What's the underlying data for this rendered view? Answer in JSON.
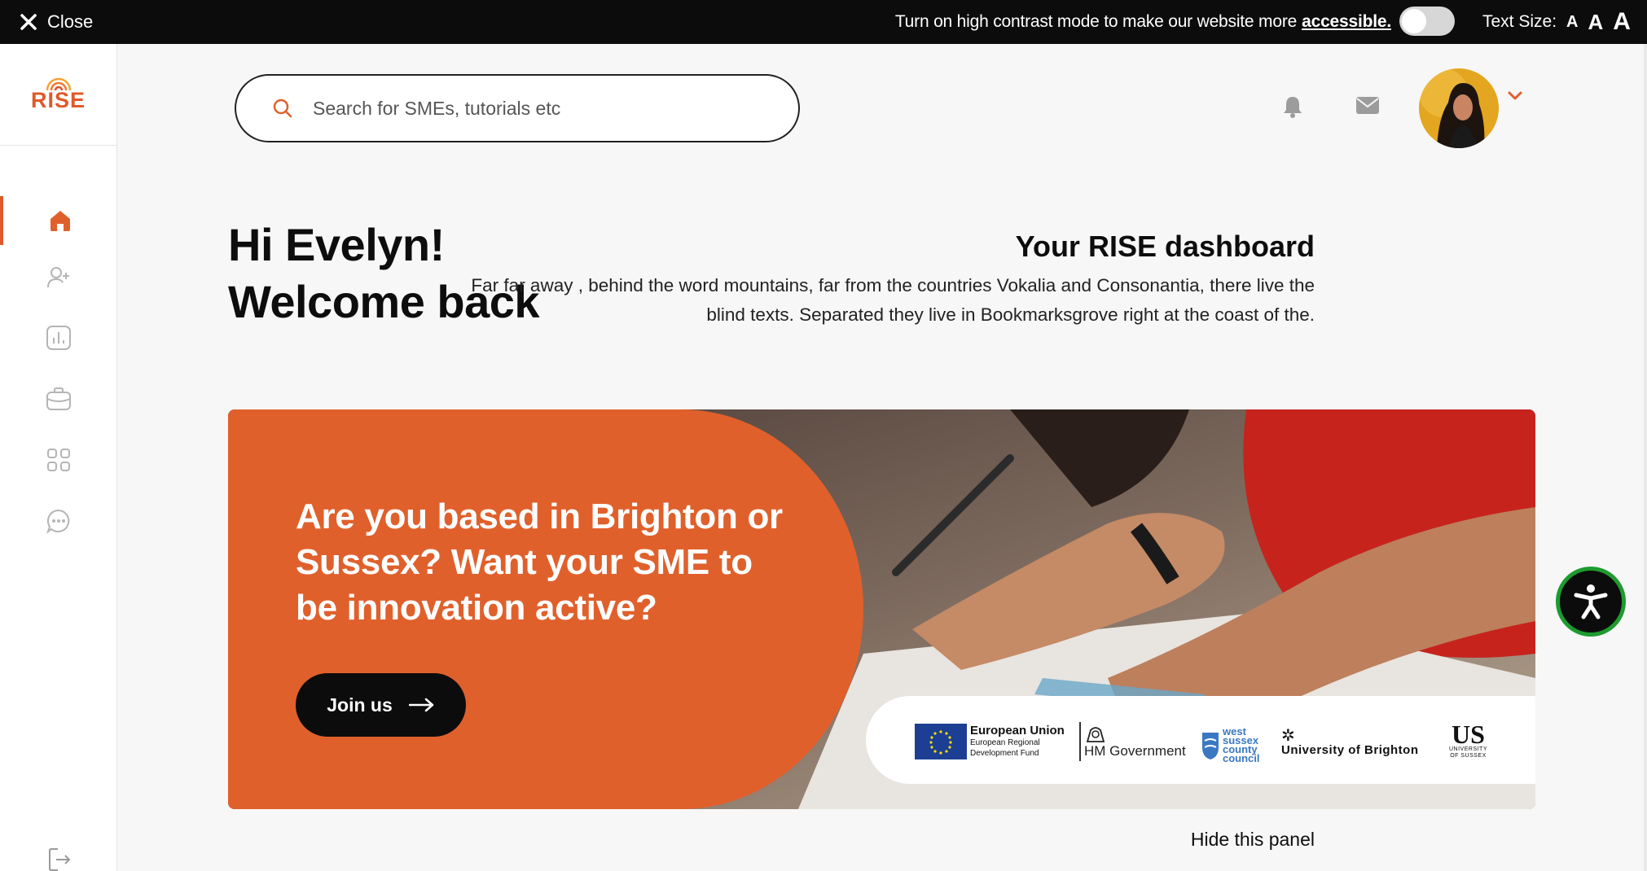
{
  "topbar": {
    "close_label": "Close",
    "contrast_text": "Turn on high contrast mode to make our website more",
    "contrast_link": "accessible.",
    "high_contrast_on": false,
    "text_size_label": "Text Size:",
    "text_size_options": [
      "A",
      "A",
      "A"
    ]
  },
  "sidebar": {
    "logo_text": "RISE",
    "items": [
      {
        "icon": "home-icon",
        "active": true
      },
      {
        "icon": "add-user-icon",
        "active": false
      },
      {
        "icon": "analytics-icon",
        "active": false
      },
      {
        "icon": "briefcase-icon",
        "active": false
      },
      {
        "icon": "grid-icon",
        "active": false
      },
      {
        "icon": "chat-icon",
        "active": false
      },
      {
        "icon": "logout-icon",
        "active": false
      }
    ]
  },
  "header": {
    "search_placeholder": "Search for SMEs, tutorials etc",
    "icons": [
      "bell-icon",
      "mail-icon",
      "avatar",
      "chevron-down-icon"
    ]
  },
  "greeting": {
    "line1": "Hi Evelyn!",
    "line2": "Welcome back"
  },
  "dashboard": {
    "title": "Your RISE dashboard",
    "description": "Far far away , behind the word mountains, far from the countries Vokalia and Consonantia, there live the blind texts. Separated they live in Bookmarksgrove right at the coast of the."
  },
  "banner": {
    "headline": "Are you based in Brighton or Sussex? Want your SME to be innovation active?",
    "cta_label": "Join us",
    "partners": {
      "eu_title": "European Union",
      "eu_line1": "European Regional",
      "eu_line2": "Development Fund",
      "hm_gov": "HM Government",
      "wscc": [
        "west",
        "sussex",
        "county",
        "council"
      ],
      "uob": "University of Brighton",
      "us_abbr": "US",
      "us_line1": "UNIVERSITY",
      "us_line2": "OF SUSSEX"
    },
    "hide_label": "Hide this panel"
  },
  "colors": {
    "accent": "#e0602c",
    "topbar_bg": "#0c0c0c",
    "a11y_ring": "#1e9b2f"
  }
}
